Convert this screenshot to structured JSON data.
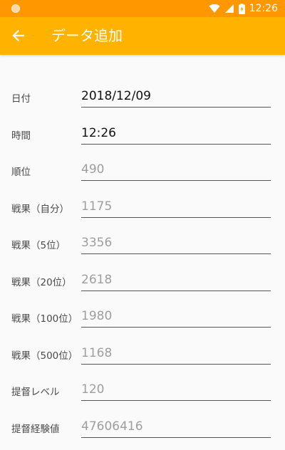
{
  "status_bar": {
    "time": "12:26"
  },
  "app_bar": {
    "title": "データ追加"
  },
  "fields": [
    {
      "label": "日付",
      "text": "2018/12/09",
      "kind": "value"
    },
    {
      "label": "時間",
      "text": "12:26",
      "kind": "value"
    },
    {
      "label": "順位",
      "text": "490",
      "kind": "hint"
    },
    {
      "label": "戦果（自分）",
      "text": "1175",
      "kind": "hint"
    },
    {
      "label": "戦果（5位）",
      "text": "3356",
      "kind": "hint"
    },
    {
      "label": "戦果（20位）",
      "text": "2618",
      "kind": "hint"
    },
    {
      "label": "戦果（100位）",
      "text": "1980",
      "kind": "hint"
    },
    {
      "label": "戦果（500位）",
      "text": "1168",
      "kind": "hint"
    },
    {
      "label": "提督レベル",
      "text": "120",
      "kind": "hint"
    },
    {
      "label": "提督経験値",
      "text": "47606416",
      "kind": "hint"
    }
  ]
}
